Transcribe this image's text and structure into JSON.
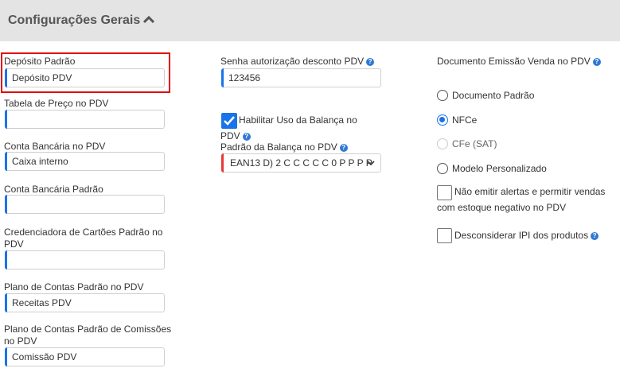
{
  "header": {
    "title": "Configurações Gerais"
  },
  "col1": {
    "deposito": {
      "label": "Depósito Padrão",
      "value": "Depósito PDV"
    },
    "tabela_preco": {
      "label": "Tabela de Preço no PDV",
      "value": ""
    },
    "conta_bancaria_pdv": {
      "label": "Conta Bancária no PDV",
      "value": "Caixa interno"
    },
    "conta_bancaria_padrao": {
      "label": "Conta Bancária Padrão",
      "value": ""
    },
    "credenciadora": {
      "label_line1": "Credenciadora de Cartões Padrão no",
      "label_line2": "PDV",
      "value": ""
    },
    "plano_contas": {
      "label": "Plano de Contas Padrão no PDV",
      "value": "Receitas PDV"
    },
    "plano_comissoes": {
      "label_line1": "Plano de Contas Padrão de Comissões",
      "label_line2": "no PDV",
      "value": "Comissão PDV"
    }
  },
  "col2": {
    "senha": {
      "label": "Senha autorização desconto PDV",
      "value": "123456"
    },
    "balanca_check": {
      "label_line1": "Habilitar Uso da Balança no",
      "label_line2": "PDV",
      "checked": true
    },
    "padrao_balanca": {
      "label": "Padrão da Balança no PDV",
      "value": "EAN13 D) 2 C C C C C 0 P P P P"
    }
  },
  "col3": {
    "documento_label": "Documento Emissão Venda no PDV",
    "radios": [
      {
        "label": "Documento Padrão",
        "state": "unselected"
      },
      {
        "label": "NFCe",
        "state": "selected"
      },
      {
        "label": "CFe (SAT)",
        "state": "disabled"
      },
      {
        "label": "Modelo Personalizado",
        "state": "unselected"
      }
    ],
    "alertas": {
      "label_line1": "Não emitir alertas e permitir vendas",
      "label_line2": "com estoque negativo no PDV",
      "checked": false
    },
    "ipi": {
      "label": "Desconsiderar IPI dos produtos",
      "checked": false
    }
  },
  "icons": {
    "help": "question-icon",
    "collapse": "chevron-up-icon",
    "dropdown": "chevron-down-icon"
  },
  "colors": {
    "accent": "#1a73e8",
    "highlight": "#e00000",
    "header_bg": "#e4e4e4"
  }
}
